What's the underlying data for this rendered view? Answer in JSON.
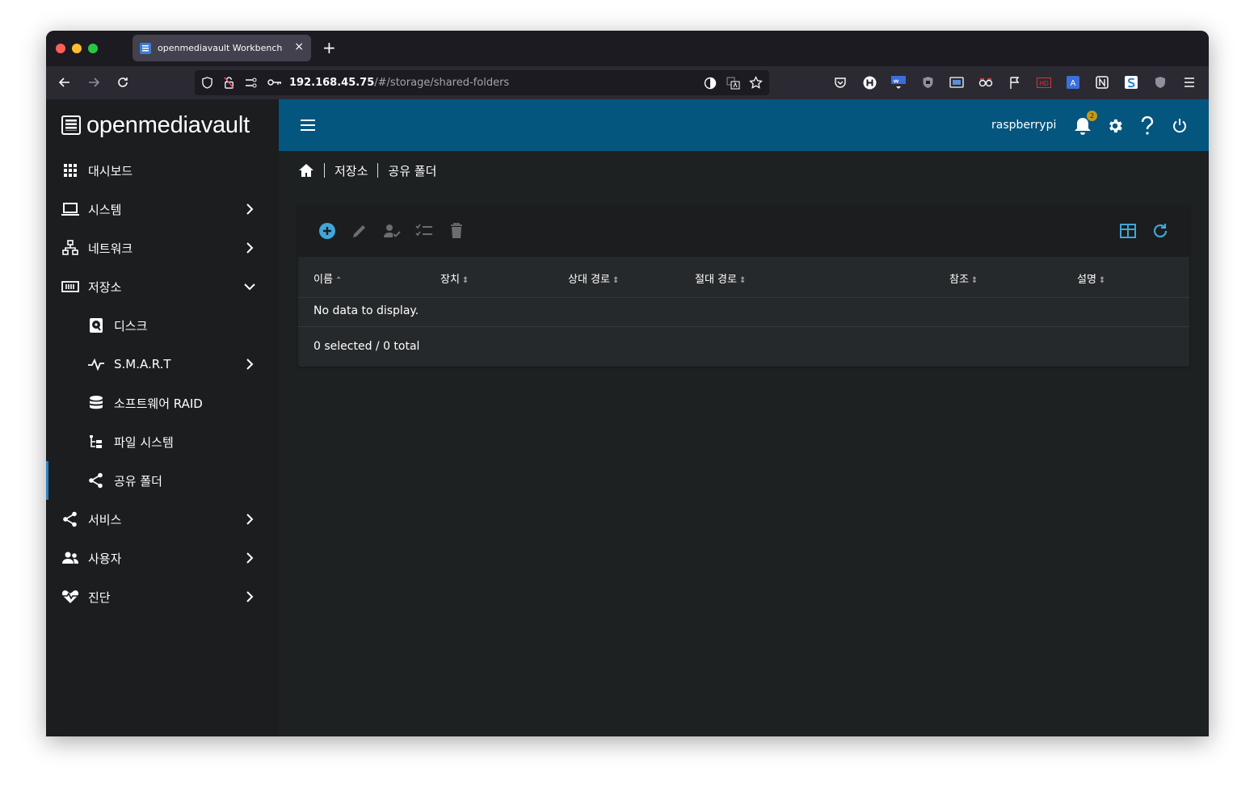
{
  "browser": {
    "tab_title": "openmediavault Workbench",
    "tab_close": "×",
    "new_tab": "+",
    "url_host": "192.168.45.75",
    "url_path": "/#/storage/shared-folders",
    "icons": [
      "back-icon",
      "forward-icon",
      "reload-icon",
      "shield-icon",
      "permissions-icon",
      "key-icon",
      "reader-icon",
      "translate-icon",
      "bookmark-star-icon",
      "pocket-icon",
      "menu-icon"
    ]
  },
  "brand": {
    "name": "openmediavault"
  },
  "sidebar": {
    "items": [
      {
        "label": "대시보드",
        "icon": "dashboard-grid-icon",
        "chevron": ""
      },
      {
        "label": "시스템",
        "icon": "laptop-icon",
        "chevron": "right"
      },
      {
        "label": "네트워크",
        "icon": "network-icon",
        "chevron": "right"
      },
      {
        "label": "저장소",
        "icon": "storage-icon",
        "chevron": "down"
      },
      {
        "label": "디스크",
        "icon": "harddisk-icon",
        "chevron": ""
      },
      {
        "label": "S.M.A.R.T",
        "icon": "pulse-icon",
        "chevron": "right"
      },
      {
        "label": "소프트웨어 RAID",
        "icon": "database-icon",
        "chevron": ""
      },
      {
        "label": "파일 시스템",
        "icon": "file-tree-icon",
        "chevron": ""
      },
      {
        "label": "공유 폴더",
        "icon": "share-icon",
        "chevron": ""
      },
      {
        "label": "서비스",
        "icon": "share-icon",
        "chevron": "right"
      },
      {
        "label": "사용자",
        "icon": "users-icon",
        "chevron": "right"
      },
      {
        "label": "진단",
        "icon": "heart-pulse-icon",
        "chevron": "right"
      }
    ]
  },
  "topbar": {
    "hostname": "raspberrypi",
    "notification_count": "2"
  },
  "breadcrumb": {
    "items": [
      "저장소",
      "공유 폴더"
    ]
  },
  "table": {
    "columns": [
      {
        "label": "이름",
        "sort": "⌃"
      },
      {
        "label": "장치",
        "sort": "⇕"
      },
      {
        "label": "상대 경로",
        "sort": "⇕"
      },
      {
        "label": "절대 경로",
        "sort": "⇕"
      },
      {
        "label": "참조",
        "sort": "⇕"
      },
      {
        "label": "설명",
        "sort": "⇕"
      }
    ],
    "empty_message": "No data to display.",
    "footer": "0 selected / 0 total"
  },
  "colors": {
    "topbar": "#04567f",
    "accent": "#42a5d8",
    "sidebar": "#1b1d1e",
    "content": "#1e2122"
  }
}
